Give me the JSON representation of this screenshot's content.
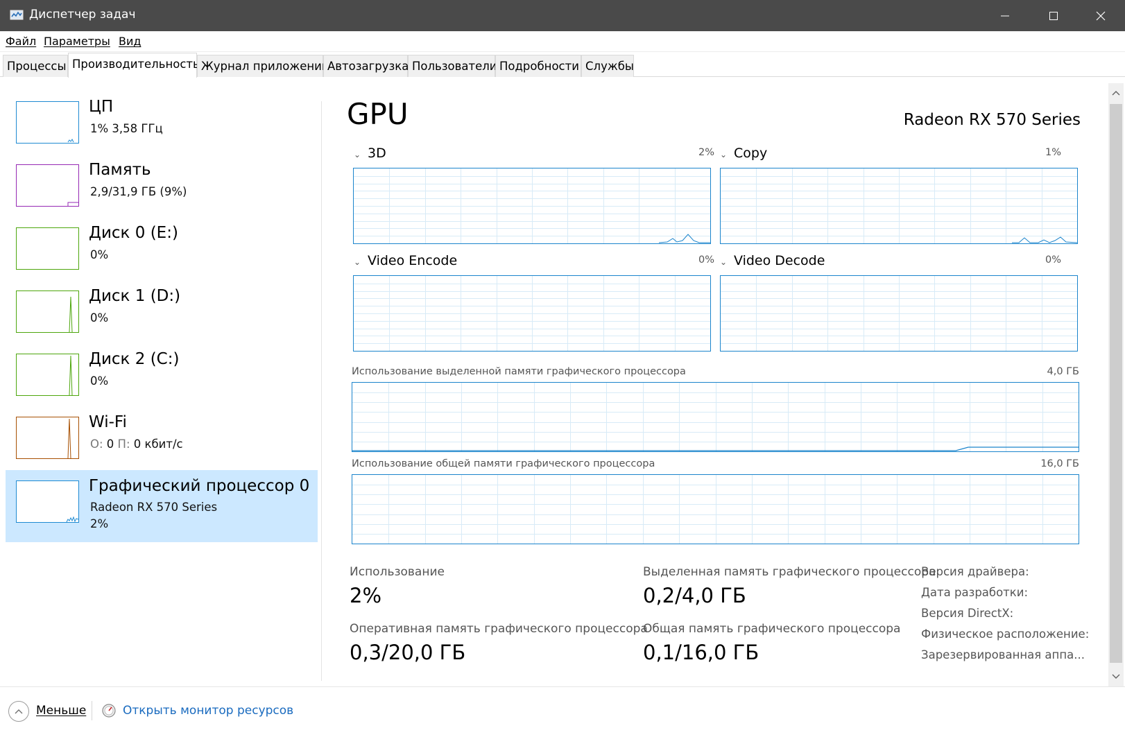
{
  "window": {
    "title": "Диспетчер задач",
    "icon": "task-manager-icon",
    "controls": [
      "minimize-icon",
      "maximize-icon",
      "close-icon"
    ]
  },
  "menu": {
    "items": [
      "Файл",
      "Параметры",
      "Вид"
    ]
  },
  "tabs": {
    "items": [
      "Процессы",
      "Производительность",
      "Журнал приложений",
      "Автозагрузка",
      "Пользователи",
      "Подробности",
      "Службы"
    ],
    "active": "Производительность"
  },
  "sidebar": {
    "items": [
      {
        "name": "ЦП",
        "line1": "1%  3,58 ГГц",
        "color": "#1e8ad2"
      },
      {
        "name": "Память",
        "line1": "2,9/31,9 ГБ (9%)",
        "color": "#9528b4"
      },
      {
        "name": "Диск 0 (E:)",
        "line1": "0%",
        "color": "#4da60c"
      },
      {
        "name": "Диск 1 (D:)",
        "line1": "0%",
        "color": "#4da60c"
      },
      {
        "name": "Диск 2 (C:)",
        "line1": "0%",
        "color": "#4da60c"
      },
      {
        "name": "Wi-Fi",
        "line1_prefix_send": "О:",
        "line1_send": "0",
        "line1_prefix_recv": "П:",
        "line1_recv": "0 кбит/с",
        "color": "#a74f01"
      },
      {
        "name": "Графический процессор 0",
        "line1": "Radeon RX 570 Series",
        "line2": "2%",
        "color": "#1e8ad2",
        "selected": true
      }
    ]
  },
  "main": {
    "title": "GPU",
    "device": "Radeon RX 570 Series",
    "engines": [
      {
        "name": "3D",
        "pct": "2%"
      },
      {
        "name": "Copy",
        "pct": "1%"
      },
      {
        "name": "Video Encode",
        "pct": "0%"
      },
      {
        "name": "Video Decode",
        "pct": "0%"
      }
    ],
    "dedicated_memory": {
      "label": "Использование выделенной памяти графического процессора",
      "max": "4,0 ГБ"
    },
    "shared_memory": {
      "label": "Использование общей памяти графического процессора",
      "max": "16,0 ГБ"
    },
    "stats": {
      "utilization_label": "Использование",
      "utilization_value": "2%",
      "dedicated_label": "Выделенная память графического процессора",
      "dedicated_value": "0,2/4,0 ГБ",
      "gpu_memory_label": "Оперативная память графического процессора",
      "gpu_memory_value": "0,3/20,0 ГБ",
      "shared_label": "Общая память графического процессора",
      "shared_value": "0,1/16,0 ГБ"
    },
    "info": {
      "driver_version": "Версия драйвера:",
      "driver_date": "Дата разработки:",
      "directx": "Версия DirectX:",
      "location": "Физическое расположение:",
      "reserved": "Зарезервированная аппа..."
    }
  },
  "footer": {
    "less": "Меньше",
    "resource_monitor": "Открыть монитор ресурсов"
  },
  "colors": {
    "titlebar": "#4a4a4a",
    "graph_line": "#1a84cc",
    "grid": "#d8ebf7",
    "selected_bg": "#cce8ff",
    "link": "#1a6bbf"
  }
}
